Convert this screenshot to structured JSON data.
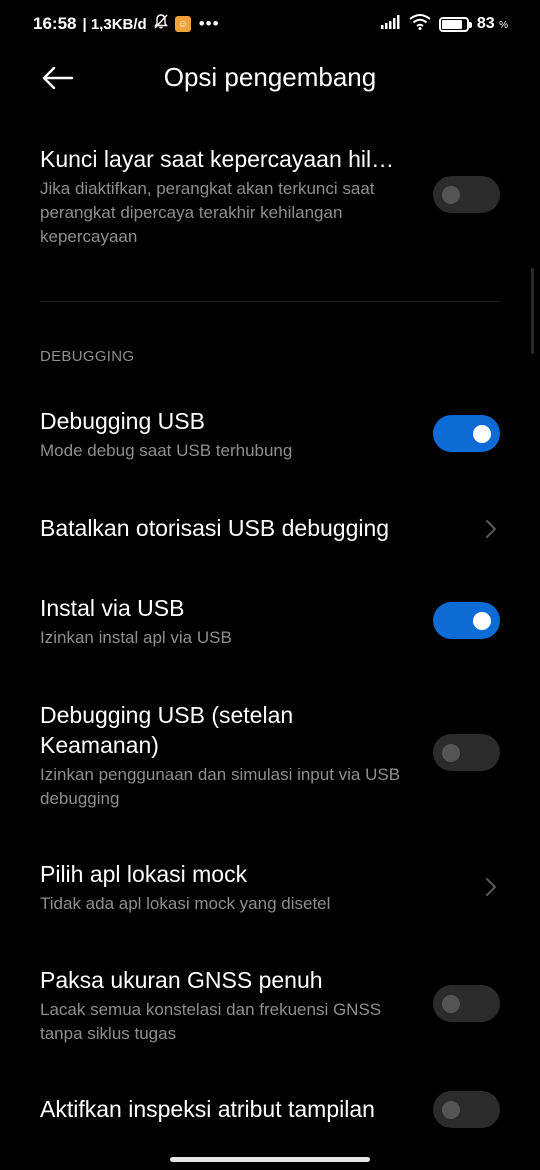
{
  "status_bar": {
    "time": "16:58",
    "speed": "| 1,3KB/d",
    "app_icon_glyph": "☺",
    "dots": "•••",
    "battery_pct": "83",
    "battery_unit": "%",
    "battery_level": 0.83
  },
  "header": {
    "title": "Opsi pengembang"
  },
  "items": [
    {
      "title": "Kunci layar saat kepercayaan hil…",
      "subtitle": "Jika diaktifkan, perangkat akan terkunci saat perangkat dipercaya terakhir kehilangan kepercayaan",
      "control": "toggle",
      "state": "off"
    },
    {
      "title": "Debugging USB",
      "subtitle": "Mode debug saat USB terhubung",
      "control": "toggle",
      "state": "on"
    },
    {
      "title": "Batalkan otorisasi USB debugging",
      "control": "chevron"
    },
    {
      "title": "Instal via USB",
      "subtitle": "Izinkan instal apl via USB",
      "control": "toggle",
      "state": "on"
    },
    {
      "title": "Debugging USB (setelan Keamanan)",
      "subtitle": "Izinkan penggunaan dan simulasi input via USB debugging",
      "control": "toggle",
      "state": "off"
    },
    {
      "title": "Pilih apl lokasi mock",
      "subtitle": "Tidak ada apl lokasi mock yang disetel",
      "control": "chevron"
    },
    {
      "title": "Paksa ukuran GNSS penuh",
      "subtitle": "Lacak semua konstelasi dan frekuensi GNSS tanpa siklus tugas",
      "control": "toggle",
      "state": "off"
    },
    {
      "title": "Aktifkan inspeksi atribut tampilan",
      "control": "toggle",
      "state": "off"
    }
  ],
  "section": {
    "debugging_label": "DEBUGGING"
  },
  "colors": {
    "background": "#000000",
    "toggle_on": "#0d6bd6",
    "toggle_off": "#2b2b2b",
    "subtitle": "#8e8e8e"
  }
}
